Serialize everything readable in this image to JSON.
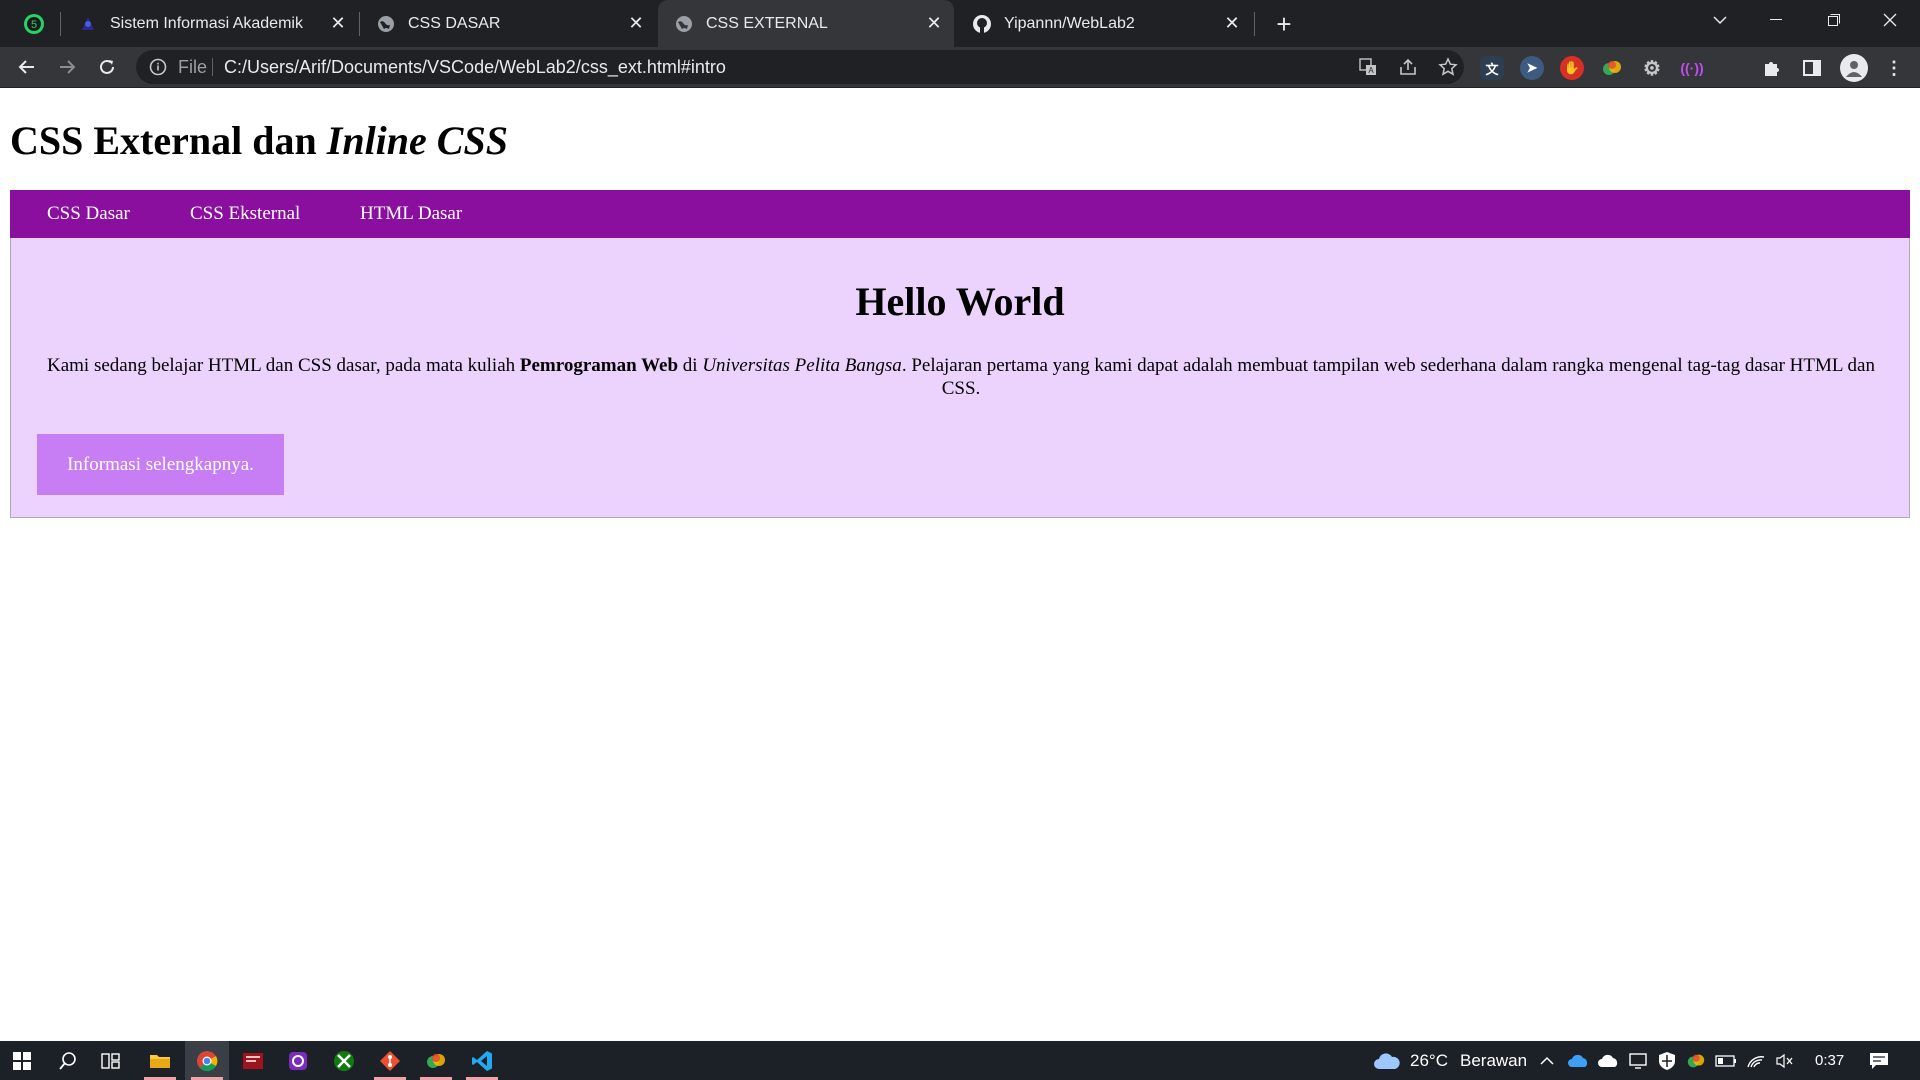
{
  "browser": {
    "pinned_tab": {
      "icon": "whatsapp-icon",
      "badge": "5"
    },
    "tabs": [
      {
        "title": "Sistem Informasi Akademik",
        "icon": "academic-logo-icon",
        "active": false
      },
      {
        "title": "CSS DASAR",
        "icon": "globe-icon",
        "active": false
      },
      {
        "title": "CSS EXTERNAL",
        "icon": "globe-icon",
        "active": true
      },
      {
        "title": "Yipannn/WebLab2",
        "icon": "github-icon",
        "active": false
      }
    ],
    "address_bar": {
      "scheme_label": "File",
      "url": "C:/Users/Arif/Documents/VSCode/WebLab2/css_ext.html#intro"
    },
    "colors": {
      "tabstrip_bg": "#202124",
      "toolbar_bg": "#35363a",
      "omnibox_bg": "#202124"
    }
  },
  "page": {
    "title_regular": "CSS External dan ",
    "title_italic": "Inline CSS",
    "nav": [
      "CSS Dasar",
      "CSS Eksternal",
      "HTML Dasar"
    ],
    "hero": {
      "heading": "Hello World",
      "text_part1": "Kami sedang belajar HTML dan CSS dasar, pada mata kuliah ",
      "text_bold": "Pemrograman Web",
      "text_part2": " di ",
      "text_italic": "Universitas Pelita Bangsa",
      "text_part3": ". Pelajaran pertama yang kami dapat adalah membuat tampilan web sederhana dalam rangka mengenal tag-tag dasar HTML dan CSS.",
      "button_label": "Informasi selengkapnya."
    },
    "colors": {
      "navbar_bg": "#8b0f9f",
      "hero_bg": "#ecd3fd",
      "button_bg": "#c77ef5"
    }
  },
  "taskbar": {
    "weather_temp": "26°C",
    "weather_desc": "Berawan",
    "time": "0:37",
    "pinned_apps": [
      "start-icon",
      "search-icon",
      "task-view-icon",
      "file-explorer-icon",
      "chrome-icon",
      "app-red-icon",
      "app-camera-icon",
      "xbox-icon",
      "git-icon",
      "app-colorful-icon",
      "vscode-icon"
    ]
  }
}
